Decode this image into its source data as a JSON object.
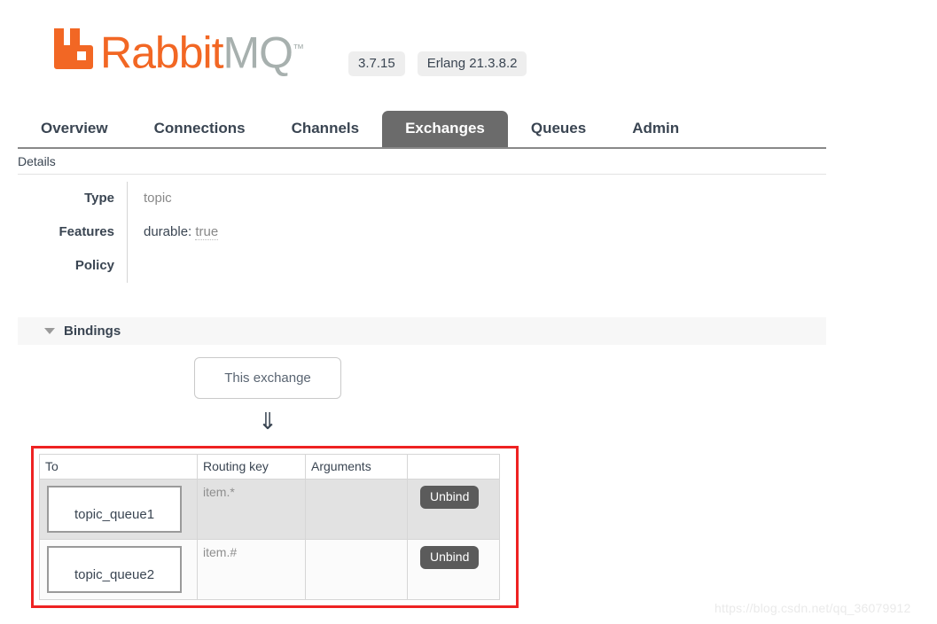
{
  "header": {
    "logo_rabbit": "Rabbit",
    "logo_mq": "MQ",
    "logo_tm": "™",
    "logo_icon_name": "rabbitmq-logo-icon",
    "version_badge": "3.7.15",
    "erlang_badge": "Erlang 21.3.8.2"
  },
  "nav": {
    "tabs": [
      {
        "label": "Overview",
        "active": false
      },
      {
        "label": "Connections",
        "active": false
      },
      {
        "label": "Channels",
        "active": false
      },
      {
        "label": "Exchanges",
        "active": true
      },
      {
        "label": "Queues",
        "active": false
      },
      {
        "label": "Admin",
        "active": false
      }
    ]
  },
  "details": {
    "section_label": "Details",
    "rows": [
      {
        "key": "Type",
        "value": "topic"
      },
      {
        "key": "Features",
        "value": ""
      },
      {
        "key": "Policy",
        "value": ""
      }
    ],
    "features": {
      "name": "durable:",
      "value": "true"
    }
  },
  "bindings": {
    "section_title": "Bindings",
    "caret_icon": "caret-down-icon",
    "exchange_node_label": "This exchange",
    "arrow_glyph": "⇓",
    "table": {
      "columns": [
        "To",
        "Routing key",
        "Arguments",
        ""
      ],
      "rows": [
        {
          "to": "topic_queue1",
          "routing_key": "item.*",
          "arguments": "",
          "action": "Unbind"
        },
        {
          "to": "topic_queue2",
          "routing_key": "item.#",
          "arguments": "",
          "action": "Unbind"
        }
      ]
    }
  },
  "watermark": "https://blog.csdn.net/qq_36079912",
  "colors": {
    "brand_orange": "#f26724",
    "logo_gray": "#a7b0ae",
    "active_tab": "#6b6b6b",
    "highlight_red": "#ee2222",
    "button_gray": "#5b5b5b"
  }
}
